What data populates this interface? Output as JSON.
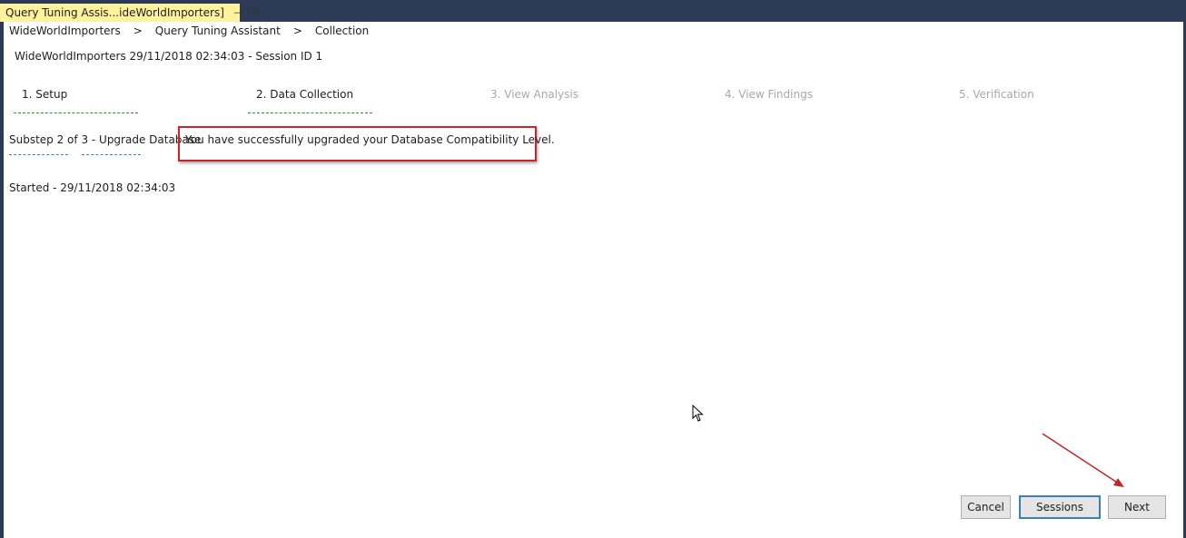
{
  "tab": {
    "title": "Query Tuning Assis...ideWorldImporters]",
    "pin_glyph": "⊣",
    "close_glyph": "✕"
  },
  "breadcrumb": {
    "items": [
      "WideWorldImporters",
      "Query Tuning Assistant",
      "Collection"
    ],
    "separator": ">"
  },
  "session_title": "WideWorldImporters 29/11/2018 02:34:03 - Session ID 1",
  "steps": [
    {
      "label": "1. Setup",
      "state": "done"
    },
    {
      "label": "2. Data Collection",
      "state": "active"
    },
    {
      "label": "3. View Analysis",
      "state": "disabled"
    },
    {
      "label": "4. View Findings",
      "state": "disabled"
    },
    {
      "label": "5. Verification",
      "state": "disabled"
    }
  ],
  "substep_label": "Substep 2 of 3 - Upgrade Database",
  "message": "You have successfully upgraded your Database Compatibility Level.",
  "started_text": "Started - 29/11/2018 02:34:03",
  "buttons": {
    "cancel": "Cancel",
    "sessions": "Sessions",
    "next": "Next"
  },
  "colors": {
    "tab_background": "#fff29d",
    "frame": "#2d3a55",
    "highlight_border": "#c8262a",
    "step_underline": "#2e8b2e",
    "substep_underline": "#3a7bd5",
    "disabled_text": "#a8a8a8"
  },
  "icons": [
    "pin-icon",
    "close-icon",
    "mouse-cursor-icon",
    "annotation-arrow-icon"
  ]
}
